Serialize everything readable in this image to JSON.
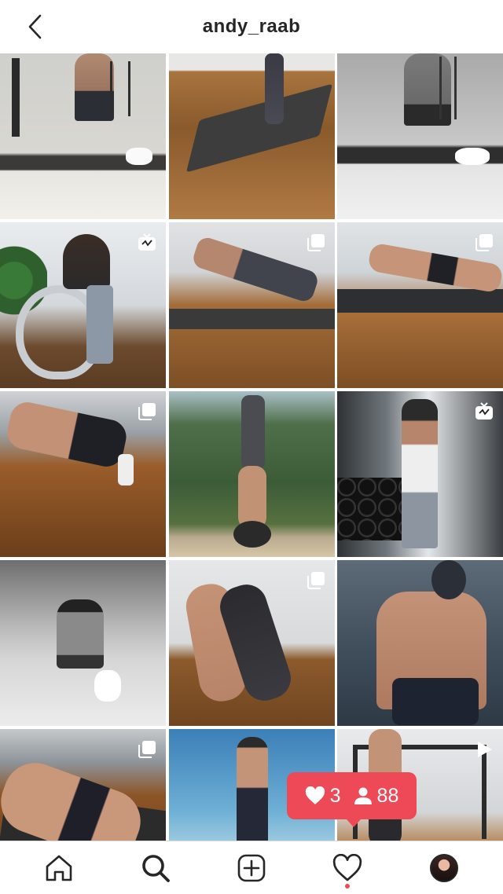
{
  "header": {
    "title": "andy_raab",
    "back_icon": "chevron-left-icon"
  },
  "grid": {
    "rows": [
      [
        {
          "name": "mirror-selfie-bathroom",
          "badge": null
        },
        {
          "name": "yoga-mat-floor",
          "badge": null
        },
        {
          "name": "mirror-selfie-bw",
          "badge": null
        }
      ],
      [
        {
          "name": "exercise-bike",
          "badge": "igtv-icon"
        },
        {
          "name": "plank-on-mat",
          "badge": "carousel-icon"
        },
        {
          "name": "floor-crunch",
          "badge": "carousel-icon"
        }
      ],
      [
        {
          "name": "kneeling-stretch",
          "badge": "carousel-icon"
        },
        {
          "name": "handstand-outdoors",
          "badge": null
        },
        {
          "name": "dumbbell-curl",
          "badge": "igtv-icon"
        }
      ],
      [
        {
          "name": "bw-mirror-selfie",
          "badge": null
        },
        {
          "name": "forward-fold-stretch",
          "badge": "carousel-icon"
        },
        {
          "name": "back-muscles",
          "badge": null
        }
      ],
      [
        {
          "name": "lying-floor-pose",
          "badge": "carousel-icon"
        },
        {
          "name": "jump-outdoors",
          "badge": null
        },
        {
          "name": "gym-rack",
          "badge": "video-icon"
        }
      ]
    ]
  },
  "activity": {
    "likes": "3",
    "followers": "88",
    "color": "#ed4956"
  },
  "nav": {
    "items": [
      "home-icon",
      "search-icon",
      "new-post-icon",
      "activity-icon",
      "profile-avatar"
    ]
  },
  "colors": {
    "text": "#262626",
    "accent": "#ed4956"
  }
}
